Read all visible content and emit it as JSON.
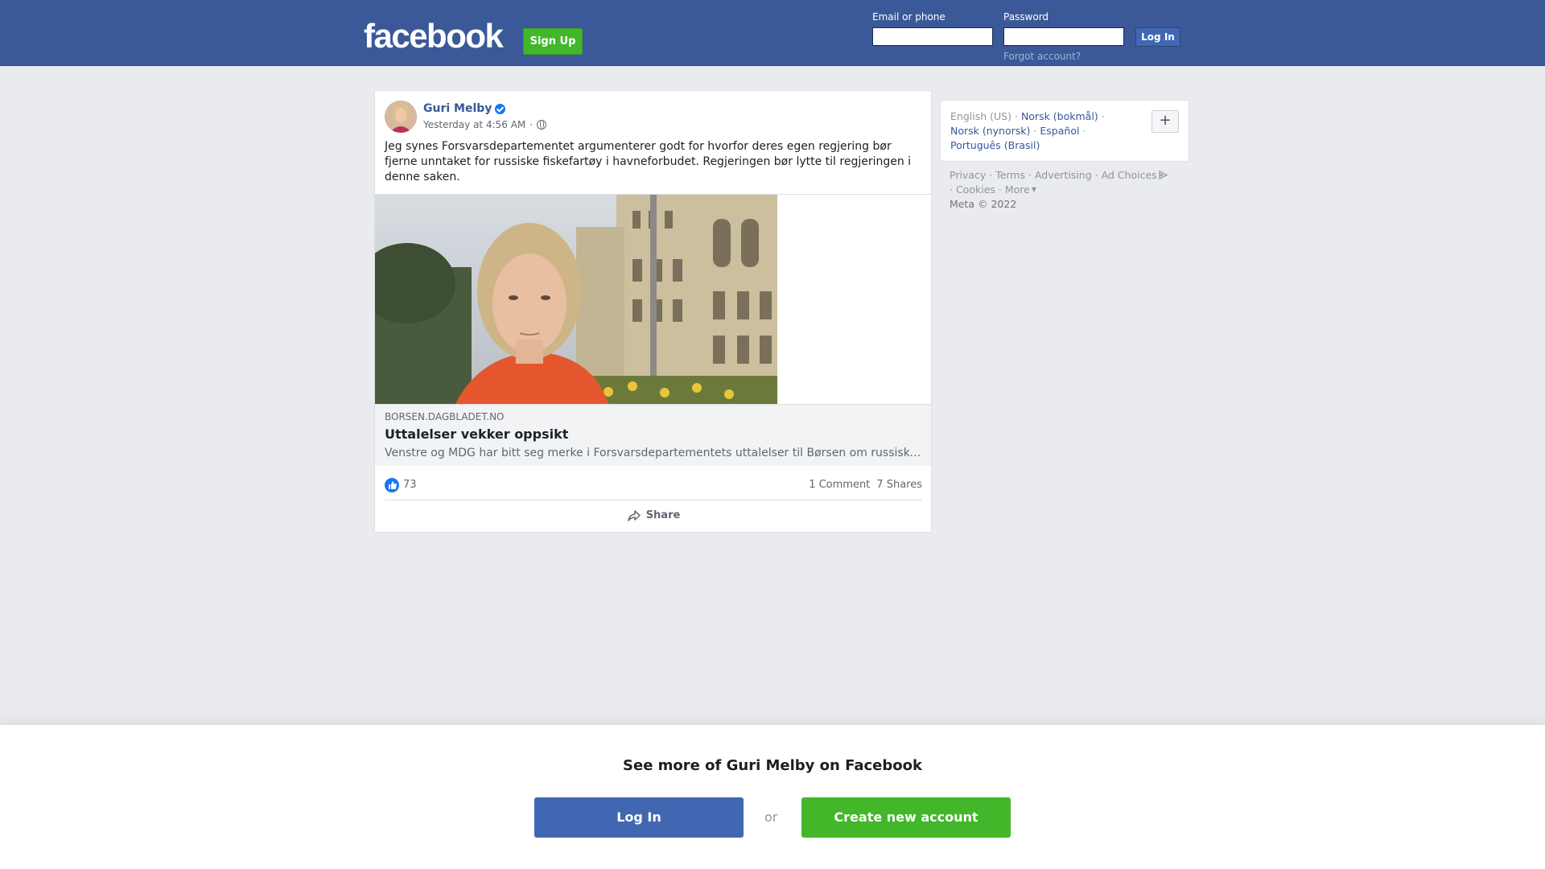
{
  "header": {
    "logo": "facebook",
    "signup_label": "Sign Up",
    "email_label": "Email or phone",
    "password_label": "Password",
    "login_label": "Log In",
    "forgot_label": "Forgot account?",
    "bg_color": "#3b5998"
  },
  "post": {
    "author": "Guri Melby",
    "timestamp": "Yesterday at 4:56 AM",
    "separator": "·",
    "text": "Jeg synes Forsvarsdepartementet argumenterer godt for hvorfor deres egen regjering bør fjerne unntaket for russiske fiskefartøy i havneforbudet. Regjeringen bør lytte til regjeringen i denne saken.",
    "link": {
      "domain": "BORSEN.DAGBLADET.NO",
      "headline": "Uttalelser vekker oppsikt",
      "description": "Venstre og MDG har bitt seg merke i Forsvarsdepartementets uttalelser til Børsen om russiske fiskefartøy"
    },
    "likes": "73",
    "comments": "1 Comment",
    "shares": "7 Shares",
    "share_label": "Share"
  },
  "sidebar": {
    "languages": {
      "current": "English (US)",
      "others": [
        "Norsk (bokmål)",
        "Norsk (nynorsk)",
        "Español",
        "Português (Brasil)"
      ],
      "add_label": "+"
    },
    "footer": {
      "links": [
        "Privacy",
        "Terms",
        "Advertising",
        "Ad Choices",
        "Cookies",
        "More"
      ],
      "copyright": "Meta © 2022"
    }
  },
  "banner": {
    "title": "See more of Guri Melby on Facebook",
    "login_label": "Log In",
    "or_label": "or",
    "create_label": "Create new account",
    "login_color": "#4267b2",
    "create_color": "#42b72a"
  }
}
